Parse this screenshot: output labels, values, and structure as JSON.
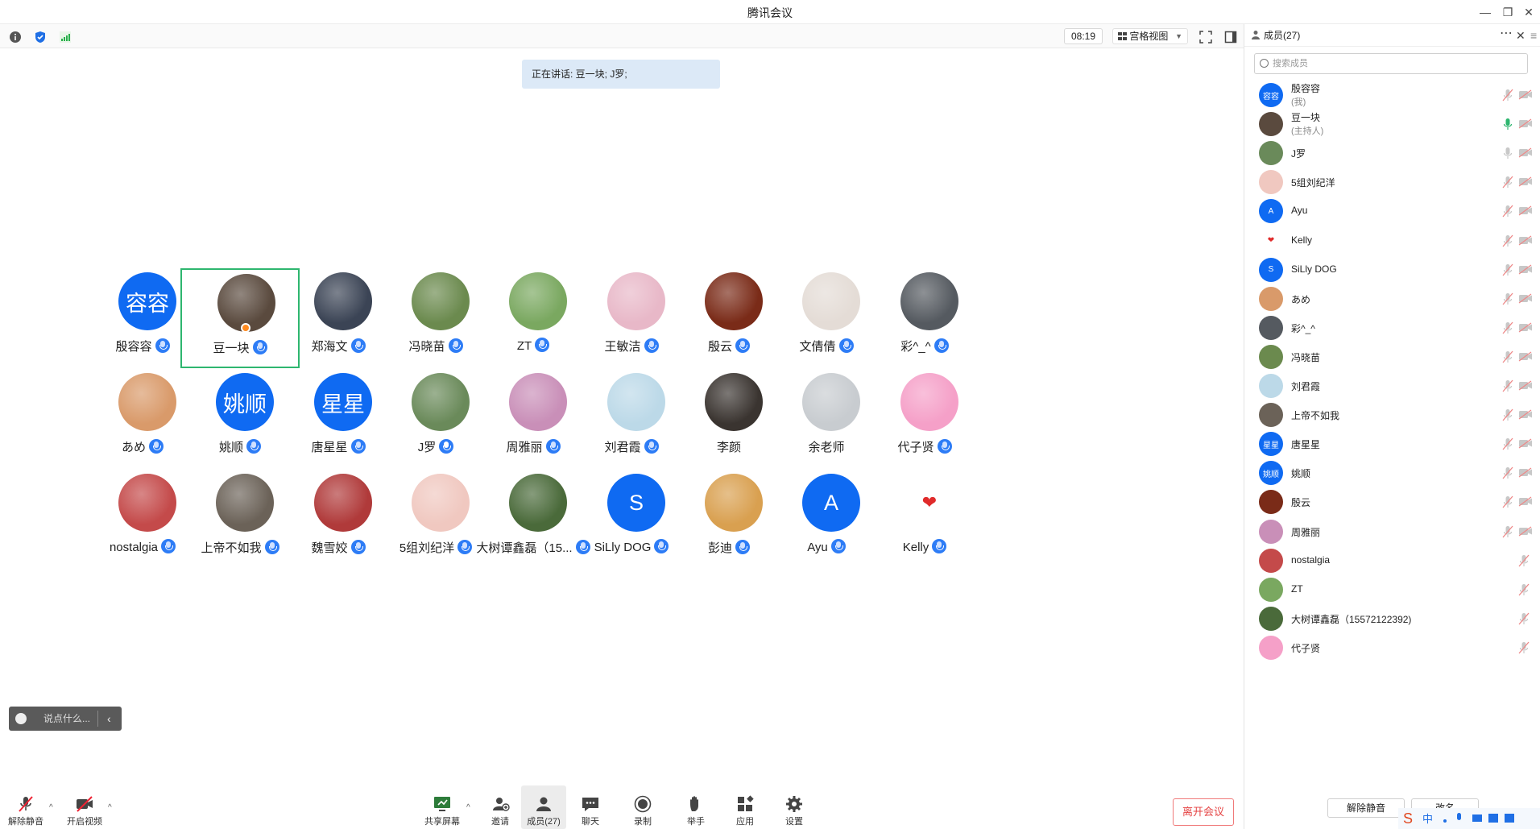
{
  "window": {
    "title": "腾讯会议"
  },
  "toolbar": {
    "timer": "08:19",
    "view_label": "宫格视图"
  },
  "speaking_banner": "正在讲话: 豆一块; J罗;",
  "grid": [
    {
      "name": "殷容容",
      "avatar_text": "容容",
      "avatar_type": "text"
    },
    {
      "name": "豆一块",
      "avatar_type": "photo",
      "color": "#5a4a3e",
      "active": true,
      "host": true
    },
    {
      "name": "郑海文",
      "avatar_type": "photo",
      "color": "#3b4455"
    },
    {
      "name": "冯晓苗",
      "avatar_type": "photo",
      "color": "#6b8a4e"
    },
    {
      "name": "ZT",
      "avatar_type": "photo",
      "color": "#7aa860"
    },
    {
      "name": "王敏洁",
      "avatar_type": "photo",
      "color": "#e8b8c8"
    },
    {
      "name": "殷云",
      "avatar_type": "photo",
      "color": "#7a2b18"
    },
    {
      "name": "文倩倩",
      "avatar_type": "photo",
      "color": "#e4dcd6"
    },
    {
      "name": "彩^_^",
      "avatar_type": "photo",
      "color": "#555a60"
    },
    {
      "name": "あめ",
      "avatar_type": "photo",
      "color": "#d99a6a"
    },
    {
      "name": "姚顺",
      "avatar_text": "姚顺",
      "avatar_type": "text"
    },
    {
      "name": "唐星星",
      "avatar_text": "星星",
      "avatar_type": "text"
    },
    {
      "name": "J罗",
      "avatar_type": "photo",
      "color": "#6a8a5a",
      "speaking": true
    },
    {
      "name": "周雅丽",
      "avatar_type": "photo",
      "color": "#c98fb8"
    },
    {
      "name": "刘君霞",
      "avatar_type": "photo",
      "color": "#bcd9e8"
    },
    {
      "name": "李颜",
      "avatar_type": "photo",
      "color": "#3a3430",
      "nomic": true
    },
    {
      "name": "余老师",
      "avatar_type": "photo",
      "color": "#c8ccd0",
      "nomic": true
    },
    {
      "name": "代子贤",
      "avatar_type": "photo",
      "color": "#f5a0c8"
    },
    {
      "name": "nostalgia",
      "avatar_type": "photo",
      "color": "#c44a4a"
    },
    {
      "name": "上帝不如我",
      "avatar_type": "photo",
      "color": "#6b6258"
    },
    {
      "name": "魏雪姣",
      "avatar_type": "photo",
      "color": "#b03a3a"
    },
    {
      "name": "5组刘纪洋",
      "avatar_type": "photo",
      "color": "#f0c8c0"
    },
    {
      "name": "大树谭鑫磊（15...",
      "avatar_type": "photo",
      "color": "#4a6a3a"
    },
    {
      "name": "SiLly DOG",
      "avatar_text": "S",
      "avatar_type": "text"
    },
    {
      "name": "彭迪",
      "avatar_type": "photo",
      "color": "#d9a050"
    },
    {
      "name": "Ayu",
      "avatar_text": "A",
      "avatar_type": "text"
    },
    {
      "name": "Kelly",
      "avatar_text": "❤",
      "avatar_type": "heart"
    }
  ],
  "chat": {
    "placeholder": "说点什么..."
  },
  "bottom": {
    "unmute": "解除静音",
    "start_video": "开启视频",
    "share": "共享屏幕",
    "invite": "邀请",
    "members": "成员(27)",
    "chat": "聊天",
    "record": "录制",
    "raise_hand": "举手",
    "apps": "应用",
    "settings": "设置",
    "leave": "离开会议"
  },
  "panel": {
    "title": "成员(27)",
    "search_placeholder": "搜索成员",
    "members": [
      {
        "name": "殷容容",
        "sub": "(我)",
        "avatar_text": "容容",
        "avatar_type": "text",
        "mic": "off",
        "cam": true
      },
      {
        "name": "豆一块",
        "sub": "(主持人)",
        "avatar_type": "photo",
        "color": "#5a4a3e",
        "mic": "on",
        "cam": true
      },
      {
        "name": "J罗",
        "avatar_type": "photo",
        "color": "#6a8a5a",
        "mic": "idle",
        "cam": true
      },
      {
        "name": "5组刘纪洋",
        "avatar_type": "photo",
        "color": "#f0c8c0",
        "mic": "off",
        "cam": true
      },
      {
        "name": "Ayu",
        "avatar_text": "A",
        "avatar_type": "text",
        "mic": "off",
        "cam": true
      },
      {
        "name": "Kelly",
        "avatar_text": "❤",
        "avatar_type": "heart",
        "mic": "off",
        "cam": true
      },
      {
        "name": "SiLly DOG",
        "avatar_text": "S",
        "avatar_type": "text",
        "mic": "off",
        "cam": true
      },
      {
        "name": "あめ",
        "avatar_type": "photo",
        "color": "#d99a6a",
        "mic": "off",
        "cam": true
      },
      {
        "name": "彩^_^",
        "avatar_type": "photo",
        "color": "#555a60",
        "mic": "off",
        "cam": true
      },
      {
        "name": "冯晓苗",
        "avatar_type": "photo",
        "color": "#6b8a4e",
        "mic": "off",
        "cam": true
      },
      {
        "name": "刘君霞",
        "avatar_type": "photo",
        "color": "#bcd9e8",
        "mic": "off",
        "cam": true
      },
      {
        "name": "上帝不如我",
        "avatar_type": "photo",
        "color": "#6b6258",
        "mic": "off",
        "cam": true
      },
      {
        "name": "唐星星",
        "avatar_text": "星星",
        "avatar_type": "text",
        "mic": "off",
        "cam": true
      },
      {
        "name": "姚顺",
        "avatar_text": "姚顺",
        "avatar_type": "text",
        "mic": "off",
        "cam": true
      },
      {
        "name": "殷云",
        "avatar_type": "photo",
        "color": "#7a2b18",
        "mic": "off",
        "cam": true
      },
      {
        "name": "周雅丽",
        "avatar_type": "photo",
        "color": "#c98fb8",
        "mic": "off",
        "cam": true
      },
      {
        "name": "nostalgia",
        "avatar_type": "photo",
        "color": "#c44a4a",
        "mic": "off",
        "cam": false
      },
      {
        "name": "ZT",
        "avatar_type": "photo",
        "color": "#7aa860",
        "mic": "off",
        "cam": false
      },
      {
        "name": "大树谭鑫磊（15572122392)",
        "avatar_type": "photo",
        "color": "#4a6a3a",
        "mic": "off",
        "cam": false
      },
      {
        "name": "代子贤",
        "avatar_type": "photo",
        "color": "#f5a0c8",
        "mic": "off",
        "cam": false
      }
    ],
    "unmute_all": "解除静音",
    "rename": "改名"
  },
  "colors": {
    "accent": "#0f6af2",
    "active_border": "#2eb66f",
    "leave": "#e54545"
  }
}
